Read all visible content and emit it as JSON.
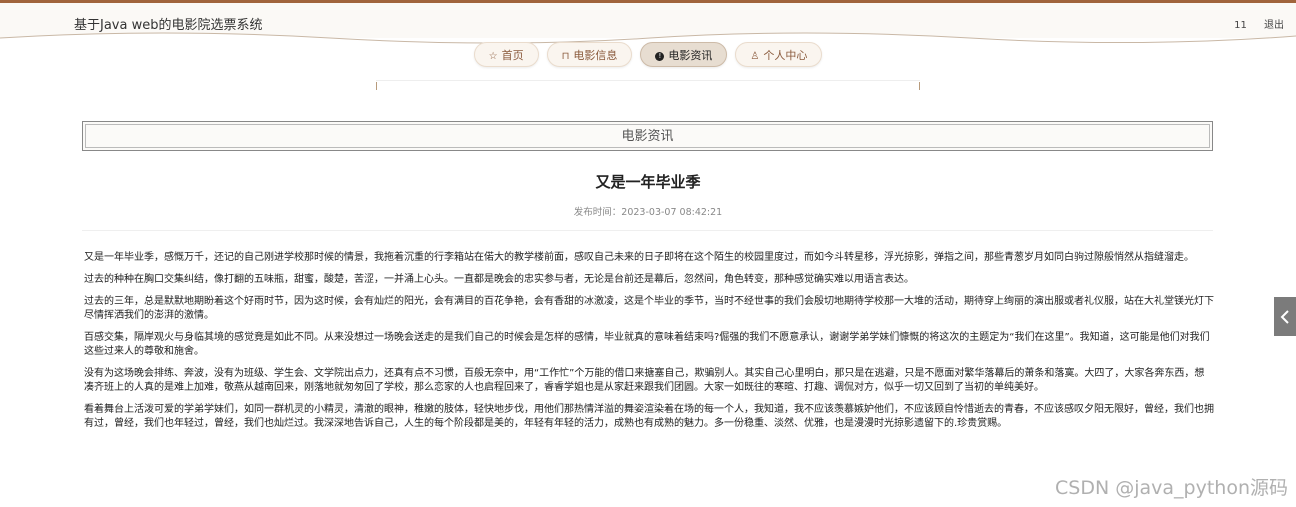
{
  "header": {
    "site_title": "基于Java web的电影院选票系统",
    "user_name": "11",
    "logout_label": "退出"
  },
  "nav": {
    "items": [
      {
        "label": "首页",
        "icon": "star-icon"
      },
      {
        "label": "电影信息",
        "icon": "bag-icon"
      },
      {
        "label": "电影资讯",
        "icon": "info-icon",
        "active": true
      },
      {
        "label": "个人中心",
        "icon": "user-icon"
      }
    ]
  },
  "section": {
    "title": "电影资讯"
  },
  "article": {
    "title": "又是一年毕业季",
    "meta": "发布时间：2023-03-07 08:42:21",
    "paragraphs": [
      "又是一年毕业季，感慨万千，还记的自己刚进学校那时候的情景，我拖着沉重的行李箱站在偌大的教学楼前面，感叹自己未来的日子即将在这个陌生的校园里度过，而如今斗转星移，浮光掠影，弹指之间，那些青葱岁月如同白驹过隙般悄然从指缝溜走。",
      "过去的种种在胸口交集纠结，像打翻的五味瓶，甜蜜，酸楚，苦涩，一并涌上心头。一直都是晚会的忠实参与者，无论是台前还是幕后，忽然间，角色转变，那种感觉确实难以用语言表达。",
      "过去的三年，总是默默地期盼着这个好雨时节，因为这时候，会有灿烂的阳光，会有满目的百花争艳，会有香甜的冰激凌，这是个毕业的季节，当时不经世事的我们会殷切地期待学校那一大堆的活动，期待穿上绚丽的演出服或者礼仪服，站在大礼堂镁光灯下尽情挥洒我们的澎湃的激情。",
      "百感交集，隔岸观火与身临其境的感觉竟是如此不同。从来没想过一场晚会送走的是我们自己的时候会是怎样的感情，毕业就真的意味着结束吗?倔强的我们不愿意承认，谢谢学弟学妹们慷慨的将这次的主题定为“我们在这里”。我知道，这可能是他们对我们这些过来人的尊敬和施舍。",
      "没有为这场晚会排练、奔波，没有为班级、学生会、文学院出点力，还真有点不习惯，百般无奈中，用“工作忙”个万能的借口来搪塞自己，欺骗别人。其实自己心里明白，那只是在逃避，只是不愿面对繁华落幕后的萧条和落寞。大四了，大家各奔东西，想凑齐班上的人真的是难上加难，敬燕从越南回来，刚落地就匆匆回了学校，那么恋家的人也启程回来了，睿睿学姐也是从家赶来跟我们团圆。大家一如既往的寒暄、打趣、调侃对方，似乎一切又回到了当初的单纯美好。",
      "看着舞台上活泼可爱的学弟学妹们，如同一群机灵的小精灵，清澈的眼神，稚嫩的肢体，轻快地步伐，用他们那热情洋溢的舞姿渲染着在场的每一个人，我知道，我不应该羡慕嫉妒他们，不应该顾自怜惜逝去的青春，不应该感叹夕阳无限好，曾经，我们也拥有过，曾经，我们也年轻过，曾经，我们也灿烂过。我深深地告诉自己，人生的每个阶段都是美的，年轻有年轻的活力，成熟也有成熟的魅力。多一份稳重、淡然、优雅，也是漫漫时光掠影遗留下的.珍贵赏赐。"
    ]
  },
  "watermark": "CSDN @java_python源码",
  "colors": {
    "accent": "#a0643c",
    "nav_text": "#8a5a3c",
    "nav_active_bg": "#e7ddd1"
  }
}
